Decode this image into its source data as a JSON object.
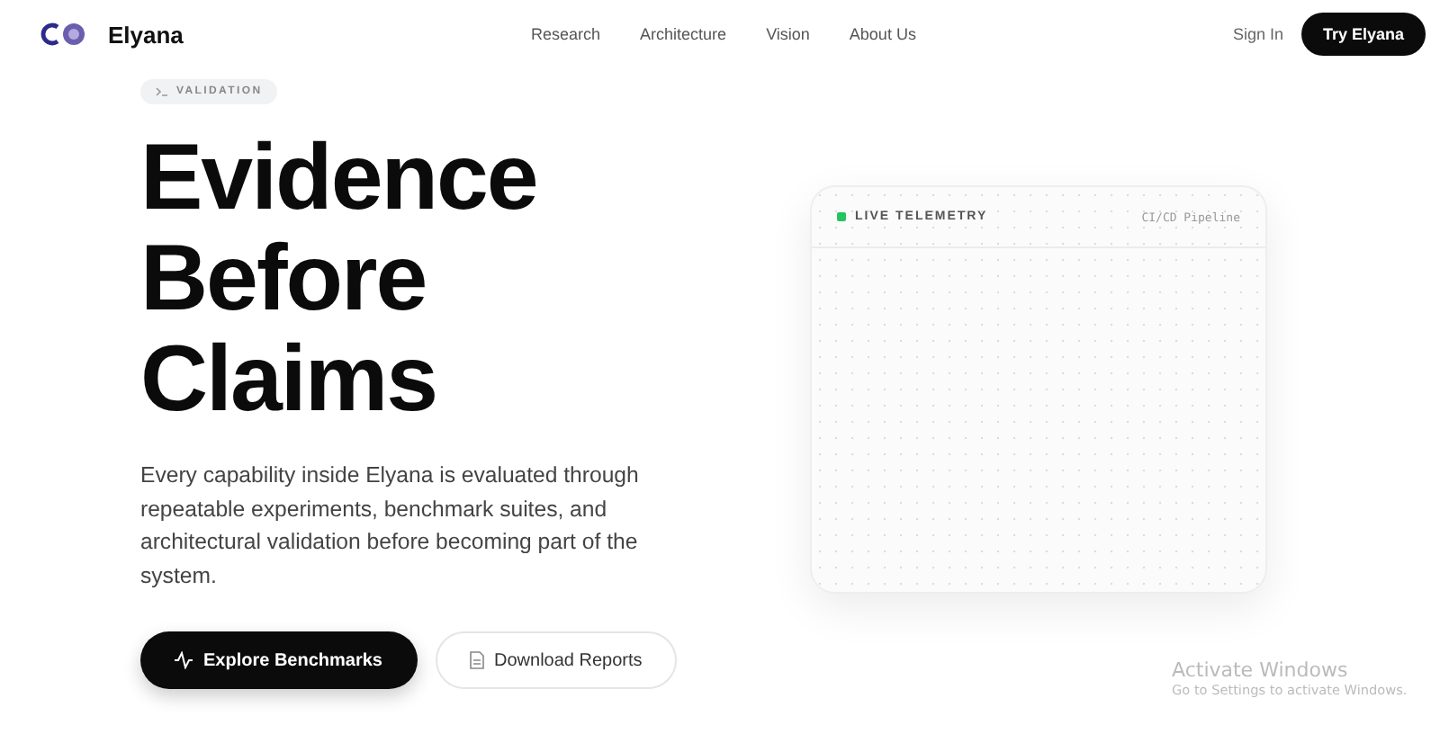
{
  "nav": {
    "brand": "Elyana",
    "links": [
      "Research",
      "Architecture",
      "Vision",
      "About Us"
    ],
    "sign_in": "Sign In",
    "cta": "Try Elyana"
  },
  "hero": {
    "badge": "VALIDATION",
    "title_lines": [
      "Evidence",
      "Before",
      "Claims"
    ],
    "description": "Every capability inside Elyana is evaluated through repeatable experiments, benchmark suites, and architectural validation before becoming part of the system.",
    "primary_button": "Explore Benchmarks",
    "secondary_button": "Download Reports"
  },
  "telemetry": {
    "live": true,
    "title": "LIVE TELEMETRY",
    "source": "CI/CD Pipeline"
  },
  "os_notice": {
    "title": "Activate Windows",
    "subtitle": "Go to Settings to activate Windows."
  }
}
